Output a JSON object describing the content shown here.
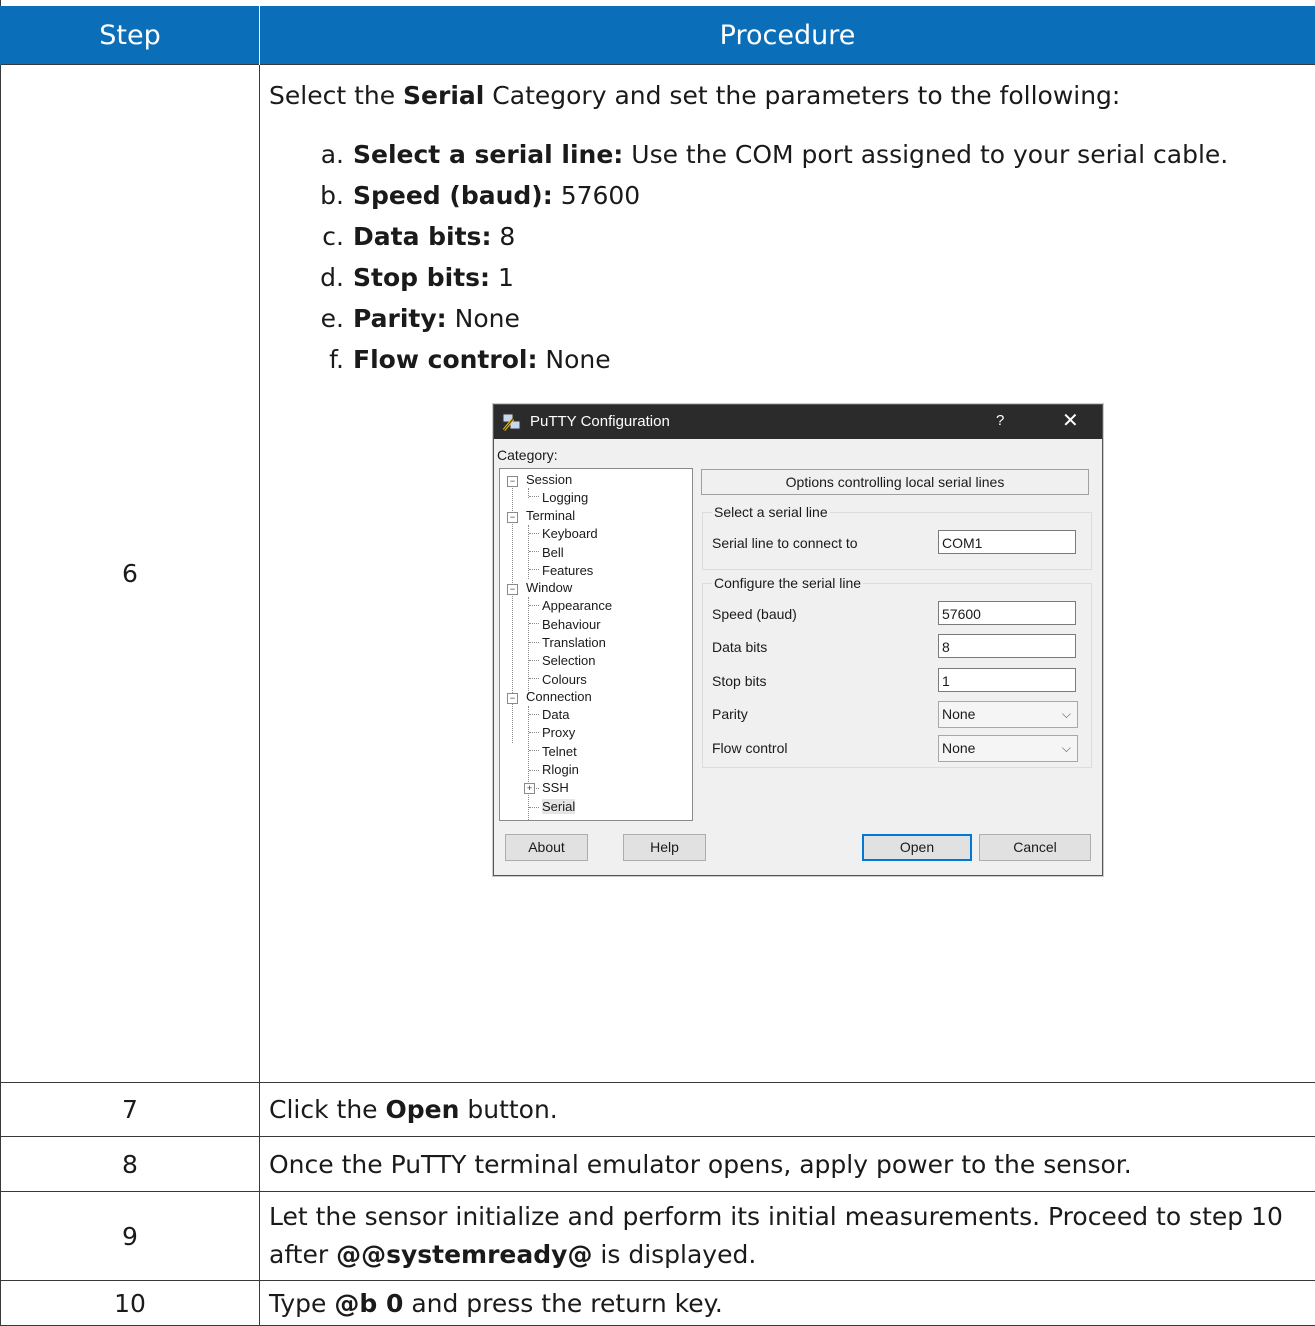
{
  "table": {
    "headers": [
      "Step",
      "Procedure"
    ],
    "rows": [
      {
        "step": "6",
        "intro_pre": "Select the ",
        "intro_bold": "Serial",
        "intro_post": " Category and set the parameters to the following:",
        "params": [
          {
            "marker": "a.",
            "label": "Select a serial line:",
            "value": "Use the COM port assigned to your serial cable."
          },
          {
            "marker": "b.",
            "label": "Speed (baud):",
            "value": "57600"
          },
          {
            "marker": "c.",
            "label": "Data bits:",
            "value": "8"
          },
          {
            "marker": "d.",
            "label": "Stop bits:",
            "value": "1"
          },
          {
            "marker": "e.",
            "label": "Parity:",
            "value": "None"
          },
          {
            "marker": "f.",
            "label": "Flow control:",
            "value": "None"
          }
        ]
      },
      {
        "step": "7",
        "pre": "Click the ",
        "bold": "Open",
        "post": " button."
      },
      {
        "step": "8",
        "text": "Once the PuTTY terminal emulator opens, apply power to the sensor."
      },
      {
        "step": "9",
        "pre": "Let the sensor initialize and perform its initial measurements. Proceed to step 10 after ",
        "bold": "@@systemready@",
        "post": " is displayed."
      },
      {
        "step": "10",
        "pre": "Type ",
        "bold": "@b 0",
        "post": " and press the return key."
      }
    ]
  },
  "putty": {
    "title": "PuTTY Configuration",
    "help_glyph": "?",
    "close_glyph": "✕",
    "category_label": "Category:",
    "tree": {
      "session": "Session",
      "logging": "Logging",
      "terminal": "Terminal",
      "keyboard": "Keyboard",
      "bell": "Bell",
      "features": "Features",
      "window": "Window",
      "appearance": "Appearance",
      "behaviour": "Behaviour",
      "translation": "Translation",
      "selection": "Selection",
      "colours": "Colours",
      "connection": "Connection",
      "data": "Data",
      "proxy": "Proxy",
      "telnet": "Telnet",
      "rlogin": "Rlogin",
      "ssh": "SSH",
      "serial": "Serial"
    },
    "panel_title": "Options controlling local serial lines",
    "group1": "Select a serial line",
    "serial_line_label": "Serial line to connect to",
    "serial_line_value": "COM1",
    "group2": "Configure the serial line",
    "speed_label": "Speed (baud)",
    "speed_value": "57600",
    "databits_label": "Data bits",
    "databits_value": "8",
    "stopbits_label": "Stop bits",
    "stopbits_value": "1",
    "parity_label": "Parity",
    "parity_value": "None",
    "flow_label": "Flow control",
    "flow_value": "None",
    "buttons": {
      "about": "About",
      "help": "Help",
      "open": "Open",
      "cancel": "Cancel"
    }
  },
  "colors": {
    "header_bg": "#0a6eb8",
    "titlebar_bg": "#2b2b2b",
    "focus_border": "#0078d7"
  }
}
